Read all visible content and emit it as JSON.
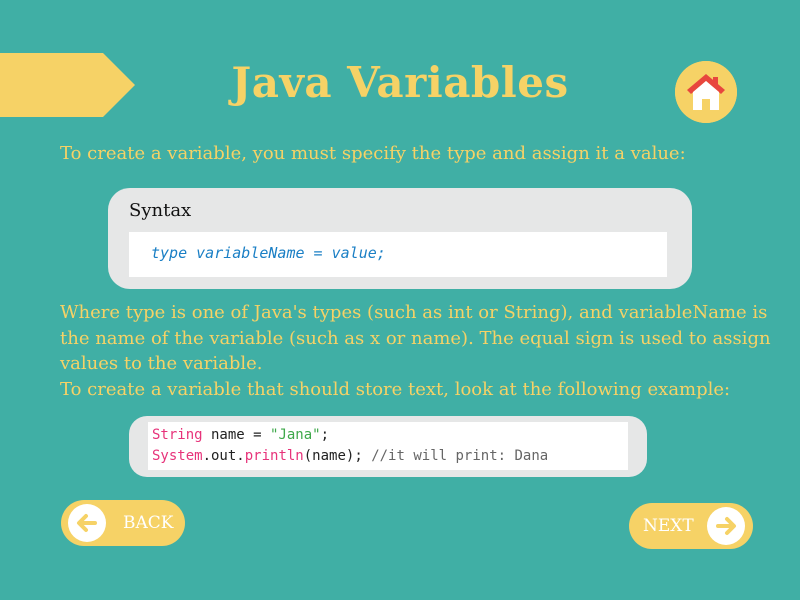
{
  "header": {
    "title": "Java Variables",
    "home_icon": "home-icon"
  },
  "intro": "To create a variable, you must specify the type and assign it a value:",
  "syntax": {
    "label": "Syntax",
    "code": "type variableName = value;"
  },
  "body": {
    "paragraph": "Where type is one of Java's types (such as int or String), and variableName is the name of the variable (such as x or name). The equal sign is used to assign values to the variable.",
    "example_intro": "To create a variable that should store text, look at the following example:"
  },
  "example": {
    "line1": {
      "type": "String",
      "rest": " name = ",
      "string": "\"Jana\"",
      "end": ";"
    },
    "line2": {
      "class": "System",
      "mid": ".out.",
      "method": "println",
      "args": "(name); ",
      "comment": "//it will print: Dana"
    }
  },
  "nav": {
    "back_label": "BACK",
    "next_label": "NEXT",
    "back_icon": "arrow-left-icon",
    "next_icon": "arrow-right-icon"
  },
  "colors": {
    "background": "#40AFA5",
    "accent": "#F6D266",
    "panel": "#E6E7E7",
    "code_blue": "#1A7FC5",
    "keyword_pink": "#E7337A",
    "string_green": "#3EA84A"
  }
}
